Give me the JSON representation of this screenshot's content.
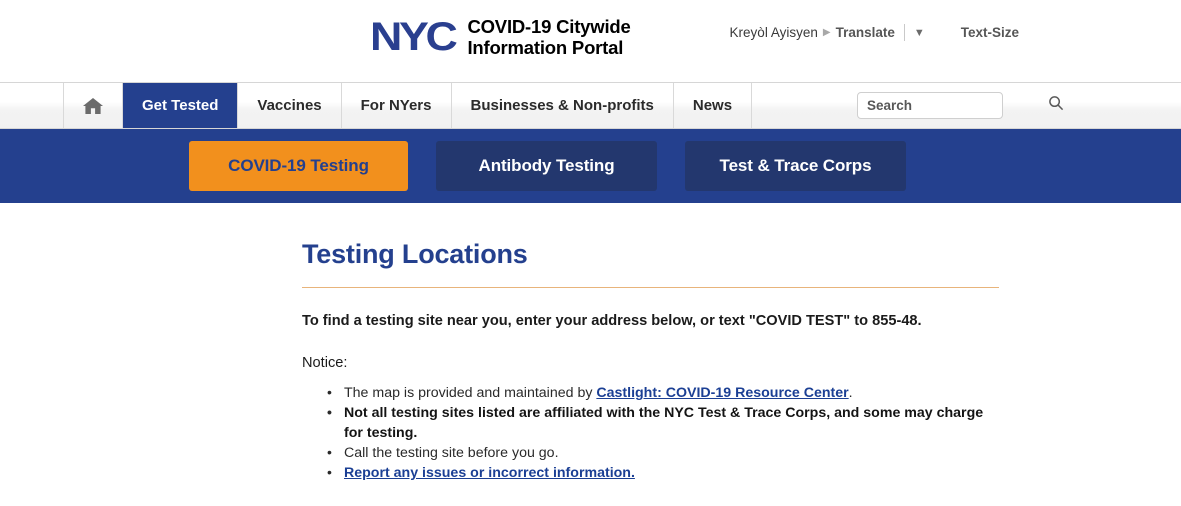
{
  "header": {
    "logo_text": "NYC",
    "portal_title_line1": "COVID-19 Citywide",
    "portal_title_line2": "Information Portal",
    "language": "Kreyòl Ayisyen",
    "translate_label": "Translate",
    "translate_arrow": "▶",
    "caret": "▼",
    "text_size": "Text-Size"
  },
  "nav": {
    "home_icon": "home-icon",
    "items": [
      {
        "label": "Get Tested",
        "active": true
      },
      {
        "label": "Vaccines",
        "active": false
      },
      {
        "label": "For NYers",
        "active": false
      },
      {
        "label": "Businesses & Non-profits",
        "active": false
      },
      {
        "label": "News",
        "active": false
      }
    ],
    "search": {
      "placeholder": "Search",
      "value": "",
      "icon": "search-icon"
    }
  },
  "subnav": {
    "tabs": [
      {
        "label": "COVID-19 Testing",
        "active": true
      },
      {
        "label": "Antibody Testing",
        "active": false
      },
      {
        "label": "Test & Trace Corps",
        "active": false
      }
    ]
  },
  "main": {
    "title": "Testing Locations",
    "intro": "To find a testing site near you, enter your address below, or text \"COVID TEST\" to 855-48.",
    "notice_label": "Notice:",
    "bullets": [
      {
        "prefix": "The map is provided and maintained by ",
        "link": "Castlight: COVID-19 Resource Center",
        "suffix": ".",
        "bold": false
      },
      {
        "prefix": "Not all testing sites listed are affiliated with the NYC Test & Trace Corps, and some may charge for testing.",
        "link": "",
        "suffix": "",
        "bold": true
      },
      {
        "prefix": "Call the testing site before you go.",
        "link": "",
        "suffix": "",
        "bold": false
      },
      {
        "prefix": "",
        "link": "Report any issues or incorrect information.",
        "suffix": "",
        "bold": false
      }
    ]
  },
  "colors": {
    "navy": "#24408E",
    "navy_dark": "#23376E",
    "orange": "#F2901D",
    "rule": "#E8B47B",
    "link": "#1B3F94"
  }
}
